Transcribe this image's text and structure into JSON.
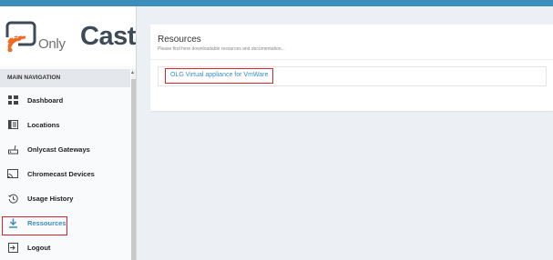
{
  "brand": {
    "only": "Only",
    "cast": "Cast"
  },
  "sidebar": {
    "header": "MAIN NAVIGATION",
    "items": [
      {
        "label": "Dashboard",
        "icon": "dashboard-icon"
      },
      {
        "label": "Locations",
        "icon": "locations-icon"
      },
      {
        "label": "Onlycast Gateways",
        "icon": "gateway-icon"
      },
      {
        "label": "Chromecast Devices",
        "icon": "chromecast-icon"
      },
      {
        "label": "Usage History",
        "icon": "history-icon"
      },
      {
        "label": "Ressources",
        "icon": "download-icon",
        "active": true
      },
      {
        "label": "Logout",
        "icon": "logout-icon"
      }
    ]
  },
  "main": {
    "title": "Resources",
    "subtitle": "Please find here downloadable resources and documentation...",
    "resources": [
      {
        "label": "OLG Virtual appliance for VmWare"
      }
    ]
  },
  "colors": {
    "accent": "#3c8dbc",
    "highlight": "#d9232e",
    "brand_orange": "#f26b21"
  }
}
